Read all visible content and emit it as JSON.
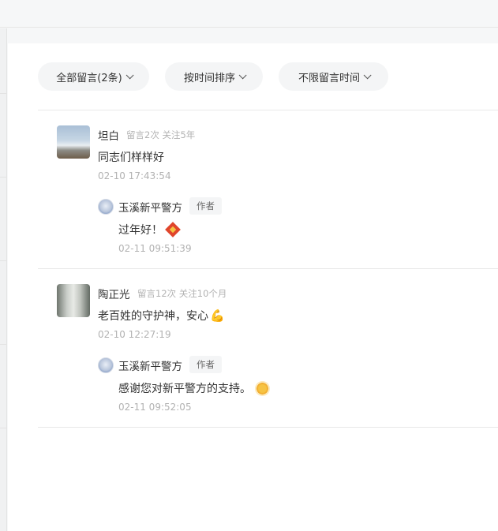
{
  "filters": {
    "all": "全部留言(2条)",
    "sort": "按时间排序",
    "range": "不限留言时间"
  },
  "comments": [
    {
      "name": "坦白",
      "meta": "留言2次 关注5年",
      "content": "同志们样样好",
      "time": "02-10 17:43:54",
      "reply": {
        "name": "玉溪新平警方",
        "badge": "作者",
        "content": "过年好！",
        "emoji": "fu-icon",
        "time": "02-11 09:51:39"
      }
    },
    {
      "name": "陶正光",
      "meta": "留言12次 关注10个月",
      "content": "老百姓的守护神，安心",
      "content_emoji": "💪",
      "time": "02-10 12:27:19",
      "reply": {
        "name": "玉溪新平警方",
        "badge": "作者",
        "content": "感谢您对新平警方的支持。",
        "emoji": "sun-icon",
        "time": "02-11 09:52:05"
      }
    }
  ]
}
